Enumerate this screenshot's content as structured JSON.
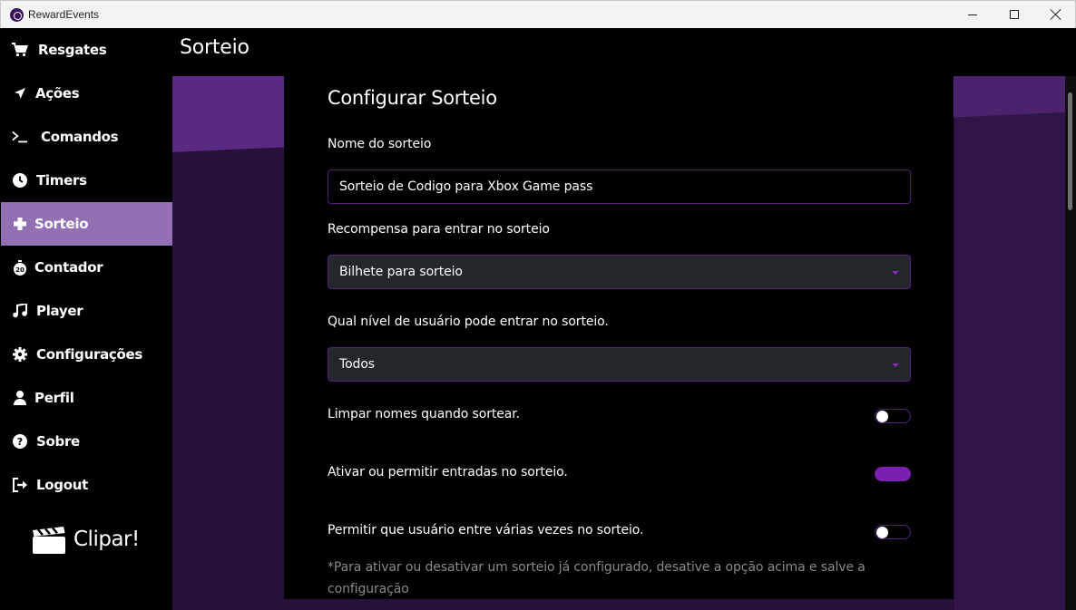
{
  "window": {
    "title": "RewardEvents"
  },
  "sidebar": {
    "items": [
      {
        "label": "Resgates",
        "icon": "cart-icon",
        "active": false
      },
      {
        "label": "Ações",
        "icon": "send-arrow-icon",
        "active": false
      },
      {
        "label": "Comandos",
        "icon": "terminal-icon",
        "active": false
      },
      {
        "label": "Timers",
        "icon": "clock-icon",
        "active": false
      },
      {
        "label": "Sorteio",
        "icon": "plus-icon",
        "active": true
      },
      {
        "label": "Contador",
        "icon": "stopwatch-icon",
        "active": false
      },
      {
        "label": "Player",
        "icon": "music-note-icon",
        "active": false
      },
      {
        "label": "Configurações",
        "icon": "gear-icon",
        "active": false
      },
      {
        "label": "Perfil",
        "icon": "user-icon",
        "active": false
      },
      {
        "label": "Sobre",
        "icon": "help-icon",
        "active": false
      },
      {
        "label": "Logout",
        "icon": "logout-icon",
        "active": false
      }
    ],
    "clip": {
      "label": "Clipar!",
      "icon": "clapperboard-icon"
    }
  },
  "header": {
    "title": "Sorteio"
  },
  "form": {
    "title": "Configurar Sorteio",
    "name_label": "Nome do sorteio",
    "name_value": "Sorteio de Codigo para Xbox Game pass",
    "reward_label": "Recompensa para entrar no sorteio",
    "reward_value": "Bilhete para sorteio",
    "level_label": "Qual nível de usuário pode entrar no sorteio.",
    "level_value": "Todos",
    "toggles": [
      {
        "label": "Limpar nomes quando sortear.",
        "on": false
      },
      {
        "label": "Ativar ou permitir entradas no sorteio.",
        "on": true
      },
      {
        "label": "Permitir que usuário entre várias vezes no sorteio.",
        "on": false
      }
    ],
    "note": "*Para ativar ou desativar um sorteio já configurado, desative a opção acima e salve a configuração"
  },
  "colors": {
    "accent": "#7b1fb0",
    "active_nav": "#9270b3",
    "border": "#5b1a80"
  }
}
